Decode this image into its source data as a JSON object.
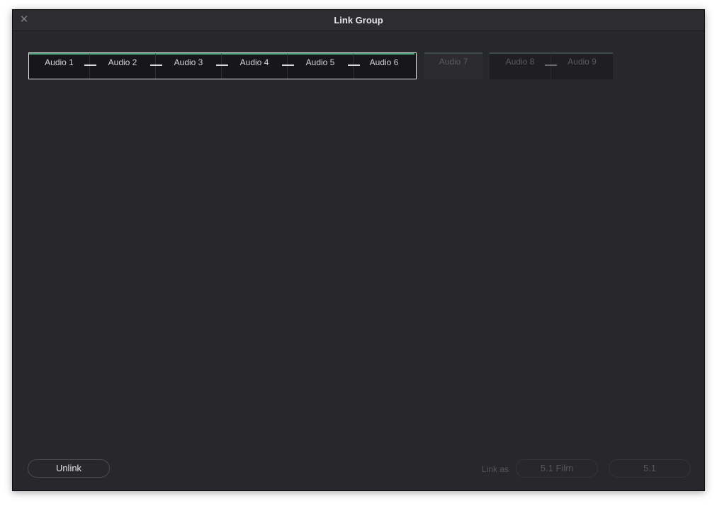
{
  "window": {
    "title": "Link Group",
    "close_icon": "close-icon"
  },
  "linked_group": {
    "tracks": [
      {
        "label": "Audio 1"
      },
      {
        "label": "Audio 2"
      },
      {
        "label": "Audio 3"
      },
      {
        "label": "Audio 4"
      },
      {
        "label": "Audio 5"
      },
      {
        "label": "Audio 6"
      }
    ]
  },
  "unlinked_track": {
    "label": "Audio 7"
  },
  "stereo_group": {
    "tracks": [
      {
        "label": "Audio 8"
      },
      {
        "label": "Audio 9"
      }
    ]
  },
  "footer": {
    "unlink_label": "Unlink",
    "link_as_label": "Link as",
    "preset_film_label": "5.1 Film",
    "preset_51_label": "5.1"
  },
  "colors": {
    "accent_green": "#4fa57f",
    "background": "#27272c",
    "selection_border": "#e8e8ea"
  }
}
